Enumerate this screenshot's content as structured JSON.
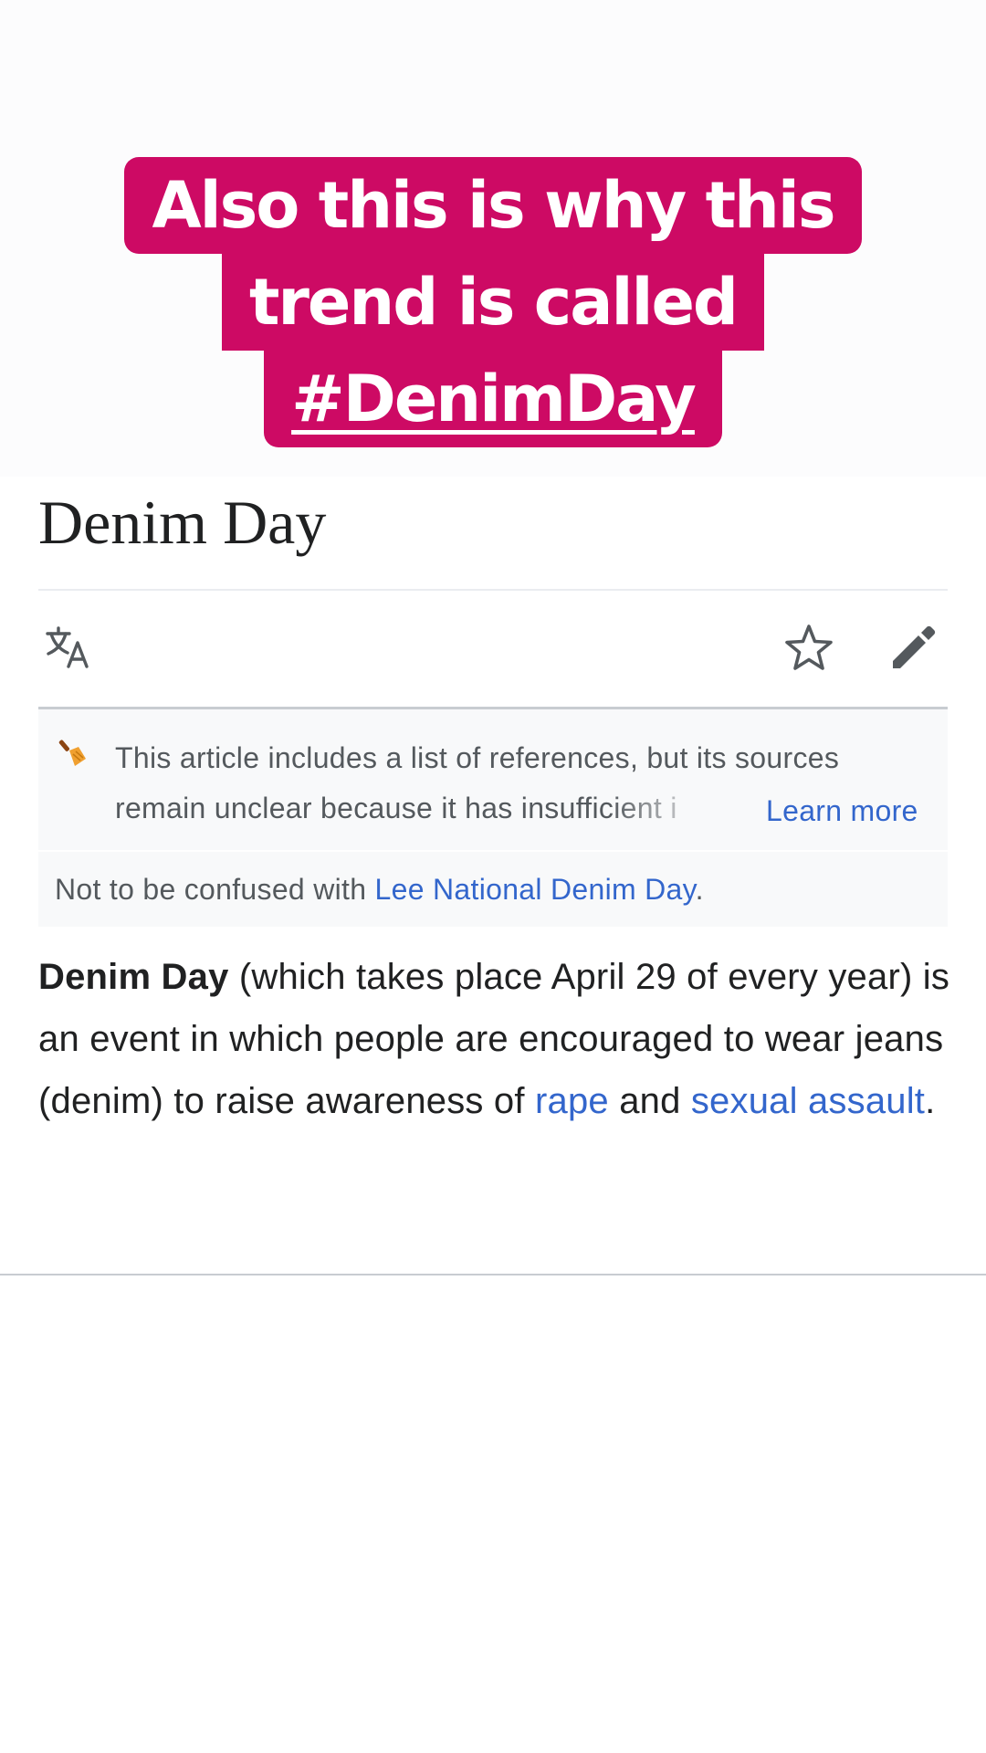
{
  "caption": {
    "line1": "Also this is why this",
    "line2": "trend is called",
    "line3": "#DenimDay",
    "background_color": "#cd0a64",
    "text_color": "#ffffff"
  },
  "article": {
    "title": "Denim Day",
    "toolbar": {
      "language_icon": "translate-icon",
      "watch_icon": "star-icon",
      "edit_icon": "pencil-icon"
    },
    "notice": {
      "icon": "broom-icon",
      "line1": "This article includes a list of references, but its sources",
      "line2": "remain unclear because it has insufficient i",
      "learn_more": "Learn more"
    },
    "hatnote": {
      "prefix": "Not to be confused with ",
      "link": "Lee National Denim Day",
      "suffix": "."
    },
    "lead": {
      "bold": "Denim Day",
      "text1": " (which takes place April 29 of every year) is an event in which people are encouraged to wear jeans (denim) to raise awareness of ",
      "link1": "rape",
      "text2": " and ",
      "link2": "sexual assault",
      "text3": "."
    },
    "link_color": "#3366cc"
  }
}
